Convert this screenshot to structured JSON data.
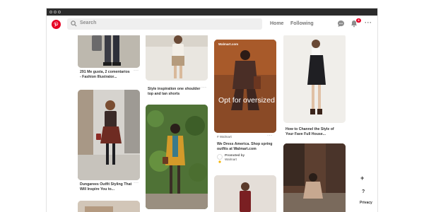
{
  "header": {
    "search_placeholder": "Search",
    "nav": [
      "Home",
      "Following"
    ],
    "notification_count": "8"
  },
  "pins": [
    {
      "title_lines": [
        "291 Me gusta, 2 comentarios",
        "- Fashion Illustrator..."
      ]
    },
    {
      "title_lines": [
        "Style inspiration one shoulder",
        "top and tan shorts"
      ]
    },
    {
      "title_lines": [
        "Dungarees Outfit Styling That",
        "Will Inspire You to..."
      ]
    },
    {
      "title_lines": [
        "How to Channel the Style of",
        "Your Fave Full House..."
      ]
    }
  ],
  "promoted": {
    "brand_tag": "Walmart.com",
    "overlay_text": "Opt for oversized",
    "source": "Walmart",
    "title_lines": [
      "We Dress America. Shop spring",
      "outfits at Walmart.com"
    ],
    "promoted_by": "Promoted by",
    "advertiser": "Walmart"
  },
  "side": {
    "plus": "+",
    "help": "?",
    "privacy": "Privacy"
  },
  "colors": {
    "brand_red": "#e60023",
    "header_bg": "#ffffff",
    "titlebar": "#2b2b2b"
  }
}
